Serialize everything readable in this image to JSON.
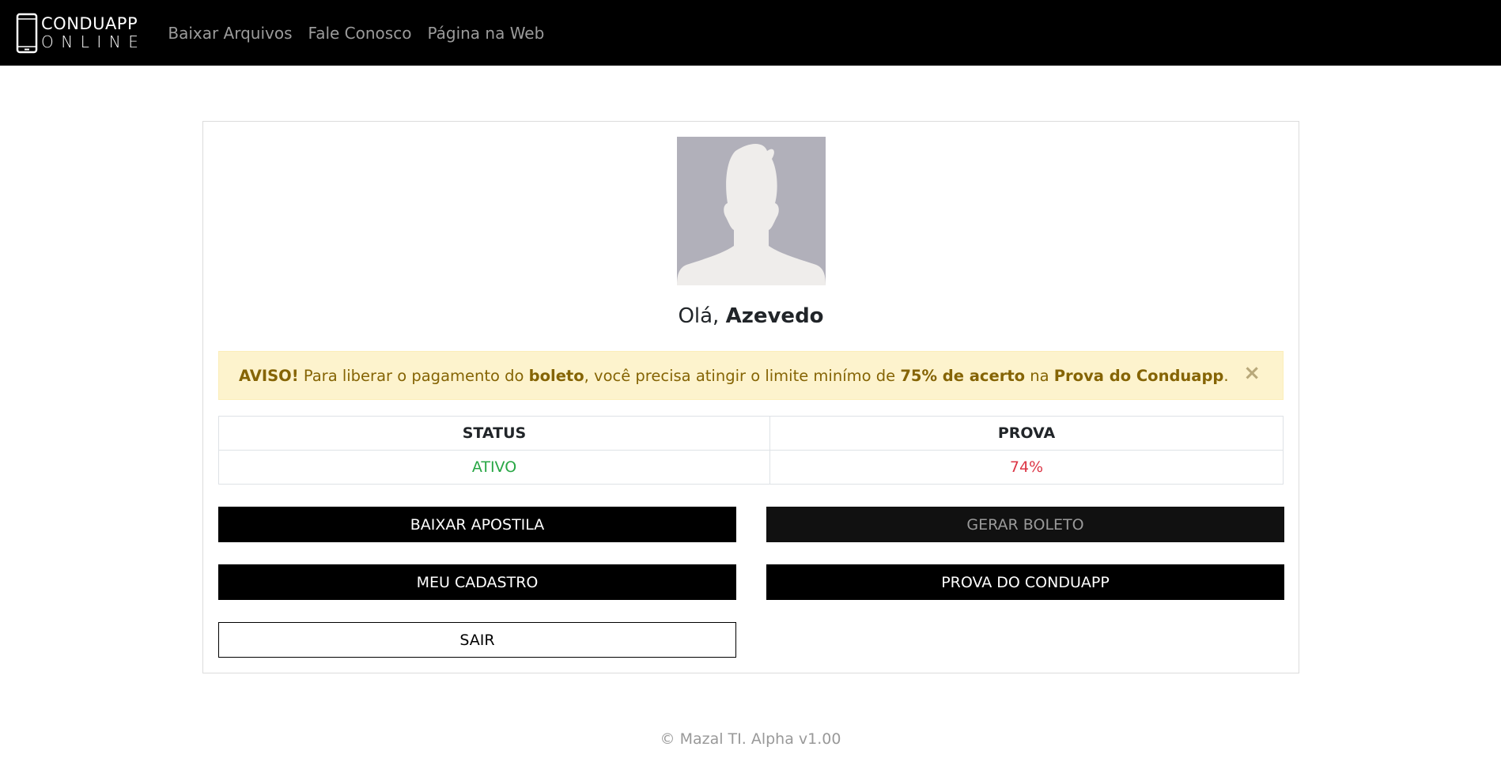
{
  "navbar": {
    "brand_top": "CONDUAPP",
    "brand_bottom": "ONLINE",
    "brand_icon": "smartphone-icon",
    "links": [
      {
        "label": "Baixar Arquivos"
      },
      {
        "label": "Fale Conosco"
      },
      {
        "label": "Página na Web"
      }
    ]
  },
  "profile": {
    "avatar_icon": "user-silhouette-icon",
    "greeting_prefix": "Olá, ",
    "user_name": "Azevedo"
  },
  "alert": {
    "label": "AVISO!",
    "text_1": " Para liberar o pagamento do ",
    "strong_1": "boleto",
    "text_2": ", você precisa atingir o limite minímo de ",
    "strong_2": "75% de acerto",
    "text_3": " na ",
    "strong_3": "Prova do Conduapp",
    "text_4": ".",
    "close_label": "×",
    "colors": {
      "background": "#fdf3cd",
      "text": "#856404"
    }
  },
  "table": {
    "headers": [
      "STATUS",
      "PROVA"
    ],
    "status_value": "ATIVO",
    "prova_value": "74%",
    "colors": {
      "status": "#28a745",
      "prova": "#dc3545"
    }
  },
  "buttons": {
    "baixar_apostila": "BAIXAR APOSTILA",
    "gerar_boleto": "GERAR BOLETO",
    "meu_cadastro": "MEU CADASTRO",
    "prova_conduapp": "PROVA DO CONDUAPP",
    "sair": "SAIR"
  },
  "footer": {
    "text": "© Mazal TI. Alpha v1.00"
  }
}
